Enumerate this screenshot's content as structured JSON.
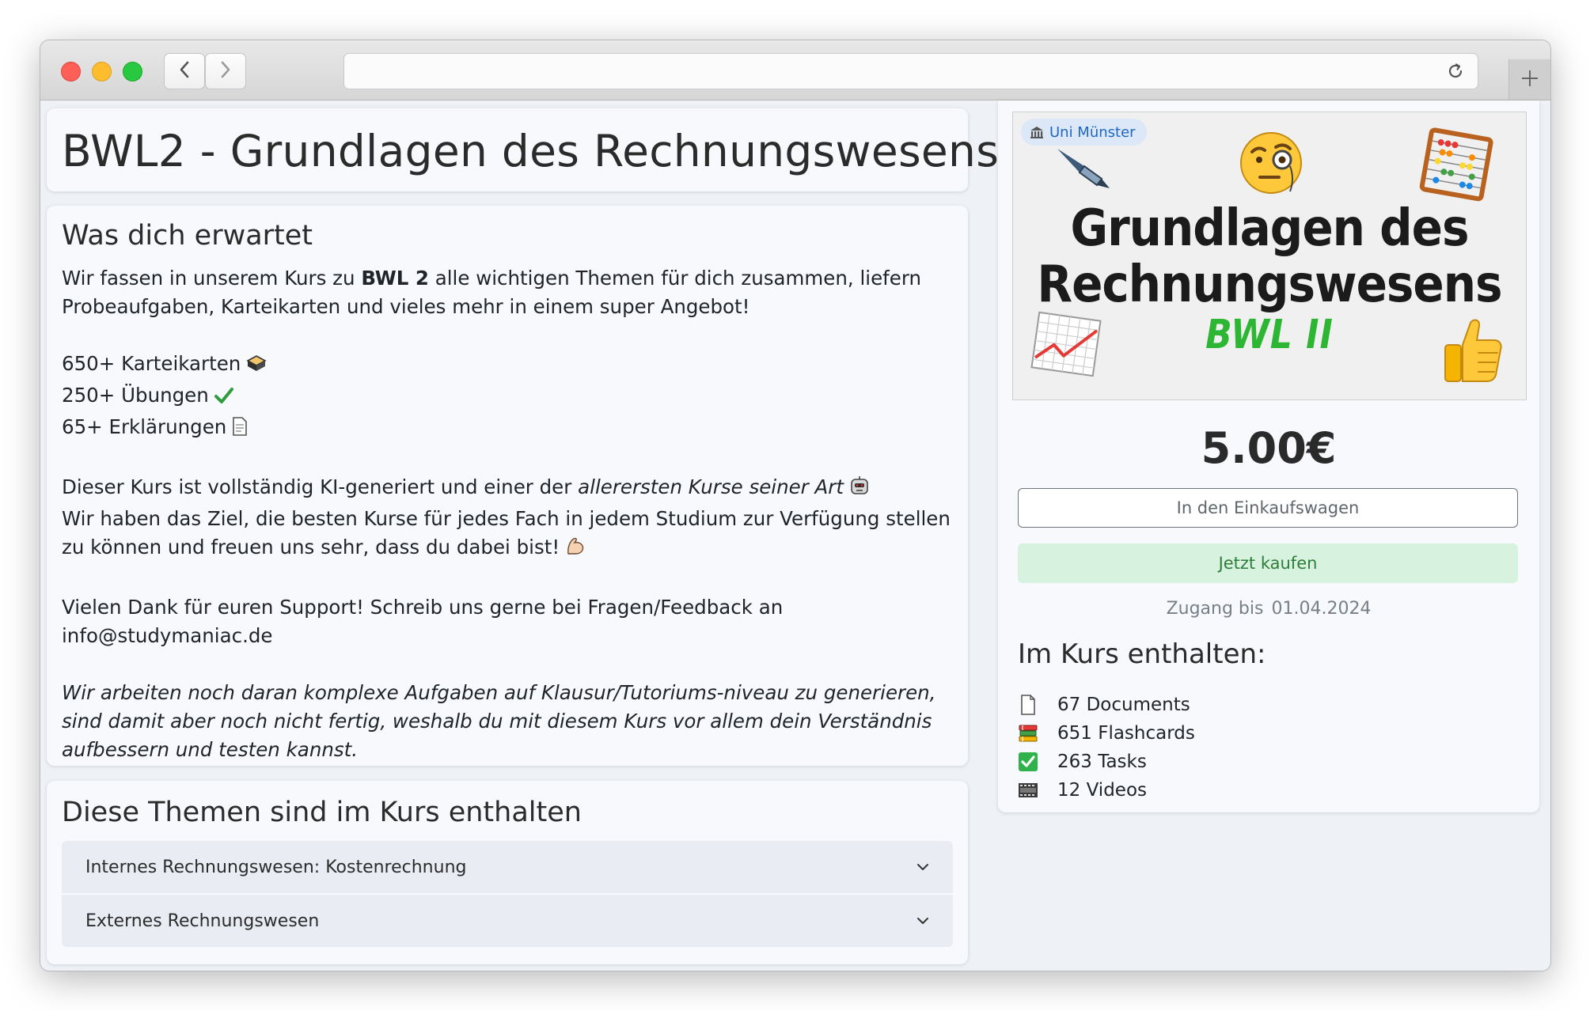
{
  "browser": {
    "url": ""
  },
  "course": {
    "title": "BWL2 - Grundlagen des Rechnungswesens"
  },
  "description": {
    "heading": "Was dich erwartet",
    "intro_pre": "Wir fassen in unserem Kurs zu ",
    "intro_bold": "BWL 2",
    "intro_post": " alle wichtigen Themen für dich zusammen, liefern",
    "intro_line2": "Probeaufgaben, Karteikarten und vieles mehr in einem super Angebot!",
    "stat_1": "650+ Karteikarten",
    "stat_2": "250+ Übungen",
    "stat_3": "65+ Erklärungen",
    "ki_pre": "Dieser Kurs ist vollständig KI-generiert und einer der ",
    "ki_italic": "allerersten Kurse seiner Art",
    "goal_line1": "Wir haben das Ziel, die besten Kurse für jedes Fach in jedem Studium zur Verfügung stellen",
    "goal_line2": "zu können und freuen uns sehr, dass du dabei bist!",
    "thanks_line1": "Vielen Dank für euren Support! Schreib uns gerne bei Fragen/Feedback an",
    "thanks_email": "info@studymaniac.de",
    "note_line1": "Wir arbeiten noch daran komplexe Aufgaben auf Klausur/Tutoriums-niveau zu generieren,",
    "note_line2": "sind damit aber noch nicht fertig, weshalb du mit diesem Kurs vor allem dein Verständnis",
    "note_line3": "aufbessern und testen kannst."
  },
  "topics": {
    "heading": "Diese Themen sind im Kurs enthalten",
    "items": [
      {
        "label": "Internes Rechnungswesen: Kostenrechnung"
      },
      {
        "label": "Externes Rechnungswesen"
      }
    ]
  },
  "sidebar": {
    "university_badge": "Uni Münster",
    "thumbnail_title_1": "Grundlagen des",
    "thumbnail_title_2": "Rechnungswesens",
    "thumbnail_subtitle": "BWL II",
    "price": "5.00€",
    "add_to_cart_label": "In den Einkaufswagen",
    "buy_now_label": "Jetzt kaufen",
    "access_label": "Zugang bis",
    "access_date": "01.04.2024",
    "included_heading": "Im Kurs enthalten:",
    "included": [
      {
        "icon": "document-icon",
        "text": "67 Documents"
      },
      {
        "icon": "books-icon",
        "text": "651 Flashcards"
      },
      {
        "icon": "checkbox-icon",
        "text": "263 Tasks"
      },
      {
        "icon": "film-icon",
        "text": "12 Videos"
      }
    ]
  },
  "colors": {
    "accent_green": "#2db534",
    "buy_button_bg": "#d7f2de",
    "badge_blue": "#1f66c5",
    "page_bg": "#eef1f6"
  }
}
